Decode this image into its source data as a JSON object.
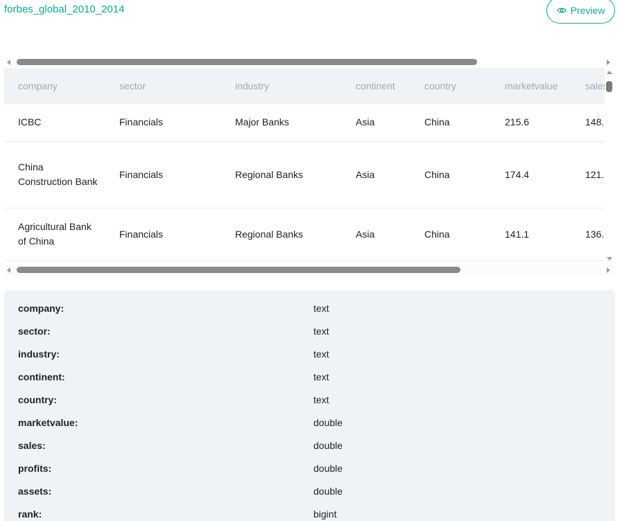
{
  "header": {
    "title": "forbes_global_2010_2014",
    "preview_label": "Preview"
  },
  "table": {
    "columns": [
      "company",
      "sector",
      "industry",
      "continent",
      "country",
      "marketvalue",
      "sales"
    ],
    "rows": [
      [
        "ICBC",
        "Financials",
        "Major Banks",
        "Asia",
        "China",
        "215.6",
        "148."
      ],
      [
        "China Construction Bank",
        "Financials",
        "Regional Banks",
        "Asia",
        "China",
        "174.4",
        "121."
      ],
      [
        "Agricultural Bank of China",
        "Financials",
        "Regional Banks",
        "Asia",
        "China",
        "141.1",
        "136."
      ]
    ]
  },
  "schema": [
    {
      "name": "company:",
      "type": "text"
    },
    {
      "name": "sector:",
      "type": "text"
    },
    {
      "name": "industry:",
      "type": "text"
    },
    {
      "name": "continent:",
      "type": "text"
    },
    {
      "name": "country:",
      "type": "text"
    },
    {
      "name": "marketvalue:",
      "type": "double"
    },
    {
      "name": "sales:",
      "type": "double"
    },
    {
      "name": "profits:",
      "type": "double"
    },
    {
      "name": "assets:",
      "type": "double"
    },
    {
      "name": "rank:",
      "type": "bigint"
    }
  ],
  "colors": {
    "accent": "#13a39a",
    "panel_bg": "#f0f3f6",
    "header_text": "#a2a9b1"
  }
}
